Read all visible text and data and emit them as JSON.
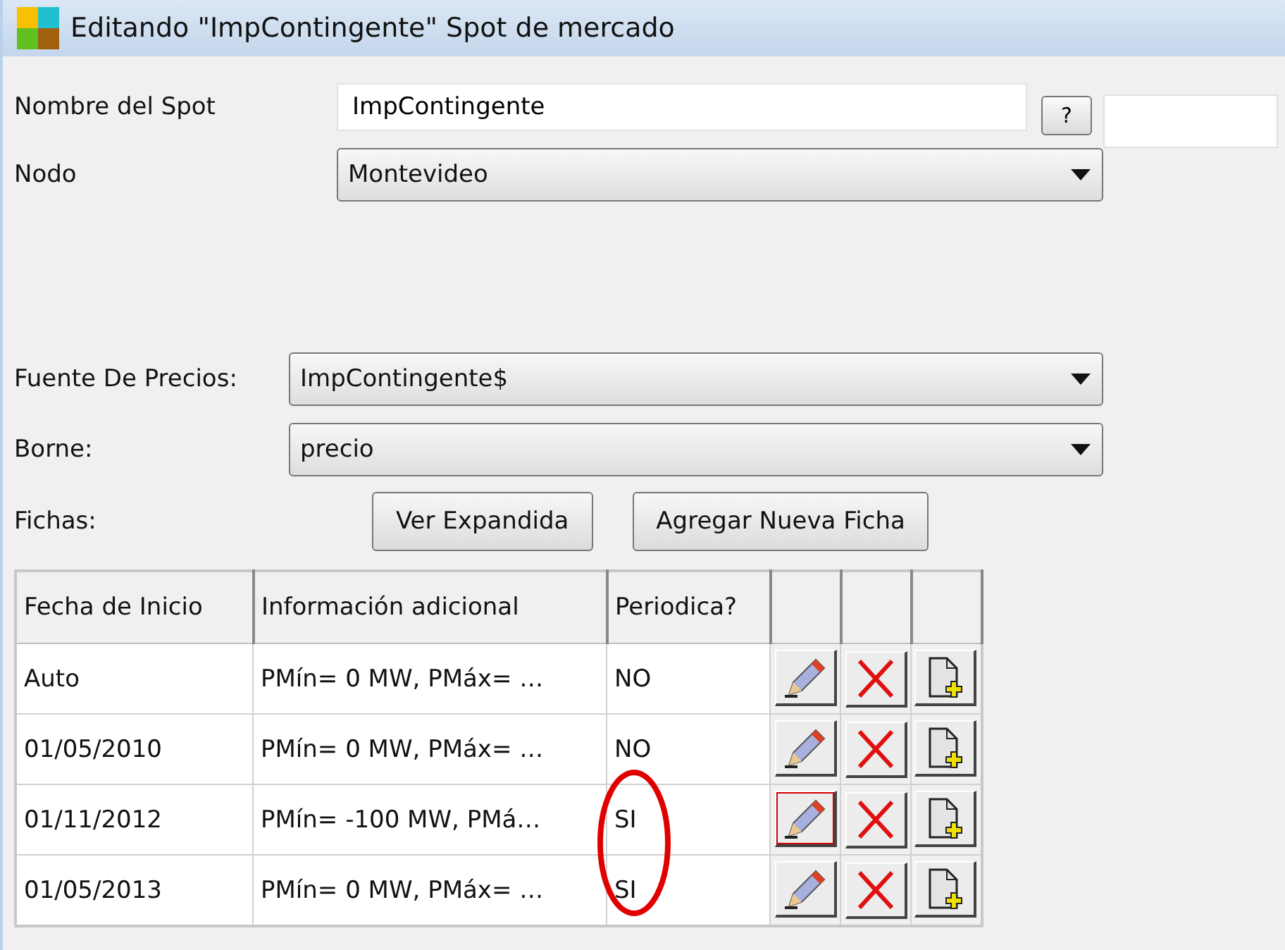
{
  "window": {
    "title": "Editando \"ImpContingente\" Spot de mercado"
  },
  "form": [
    {
      "kind": "text",
      "label": "Nombre del Spot",
      "value": "ImpContingente",
      "help": "?"
    },
    {
      "kind": "select",
      "label": "Nodo",
      "value": "Montevideo"
    },
    {
      "kind": "gap"
    },
    {
      "kind": "select",
      "label": "Fuente De Precios:",
      "value": "ImpContingente$"
    },
    {
      "kind": "select",
      "label": "Borne:",
      "value": "precio"
    }
  ],
  "fichas": {
    "label": "Fichas:",
    "buttons": [
      "Ver Expandida",
      "Agregar Nueva Ficha"
    ]
  },
  "table": {
    "columns": [
      "Fecha de Inicio",
      "Información adicional",
      "Periodica?"
    ],
    "rows": [
      {
        "cells": [
          "Auto",
          "PMín= 0 MW, PMáx= …",
          "NO"
        ],
        "edit_focused": false,
        "circled": false
      },
      {
        "cells": [
          "01/05/2010",
          "PMín= 0 MW, PMáx= …",
          "NO"
        ],
        "edit_focused": false,
        "circled": false
      },
      {
        "cells": [
          "01/11/2012",
          "PMín= -100 MW, PMá…",
          "SI"
        ],
        "edit_focused": true,
        "circled": true
      },
      {
        "cells": [
          "01/05/2013",
          "PMín= 0 MW, PMáx= …",
          "SI"
        ],
        "edit_focused": false,
        "circled": true
      }
    ]
  }
}
